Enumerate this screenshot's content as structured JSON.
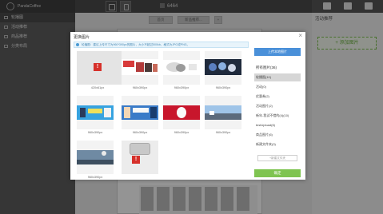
{
  "app": {
    "logo_text": "PandaCoffee",
    "page_count": "6464"
  },
  "sidebar": {
    "items": [
      {
        "label": "轮播图",
        "active": true
      },
      {
        "label": "活动推荐",
        "active": false
      },
      {
        "label": "商品推荐",
        "active": false
      },
      {
        "label": "分类布局",
        "active": false
      }
    ]
  },
  "canvas": {
    "tabs": [
      "首页",
      "新品推荐...",
      "+"
    ]
  },
  "right_panel": {
    "title": "活动推荐",
    "add_button": "+ 添加图片"
  },
  "modal": {
    "title": "更换图片",
    "close": "×",
    "tip": "轮播图：建议上传尺寸为960*390px的图片，大小不超过500kb，格式为JPG或PNG。",
    "images": [
      {
        "caption": "420x61px",
        "kind": "broken"
      },
      {
        "caption": "960x390px",
        "kind": "photo"
      },
      {
        "caption": "960x390px",
        "kind": "photo"
      },
      {
        "caption": "960x390px",
        "kind": "photo"
      },
      {
        "caption": "960x390px",
        "kind": "photo"
      },
      {
        "caption": "960x390px",
        "kind": "photo"
      },
      {
        "caption": "960x390px",
        "kind": "photo"
      },
      {
        "caption": "960x390px",
        "kind": "photo"
      },
      {
        "caption": "960x390px",
        "kind": "photo"
      },
      {
        "caption": "",
        "kind": "placeholder"
      }
    ],
    "upload_button": "上传本地图片",
    "groups_title": "所有图片(36)",
    "groups": [
      {
        "label": "轮播图(10)",
        "active": true
      },
      {
        "label": "活动(0)",
        "active": false
      },
      {
        "label": "优惠券(2)",
        "active": false
      },
      {
        "label": "活动图片(2)",
        "active": false
      },
      {
        "label": "新年-我试不错的(4)(10)",
        "active": false
      },
      {
        "label": "testUpload(6)",
        "active": false
      },
      {
        "label": "商品图片(6)",
        "active": false
      },
      {
        "label": "新建文件夹(0)",
        "active": false
      }
    ],
    "new_group_button": "+新建文件夹",
    "confirm_button": "确定"
  },
  "colors": {
    "accent_blue": "#4a90d9",
    "confirm_green": "#7fc451",
    "error_red": "#d6302a"
  }
}
